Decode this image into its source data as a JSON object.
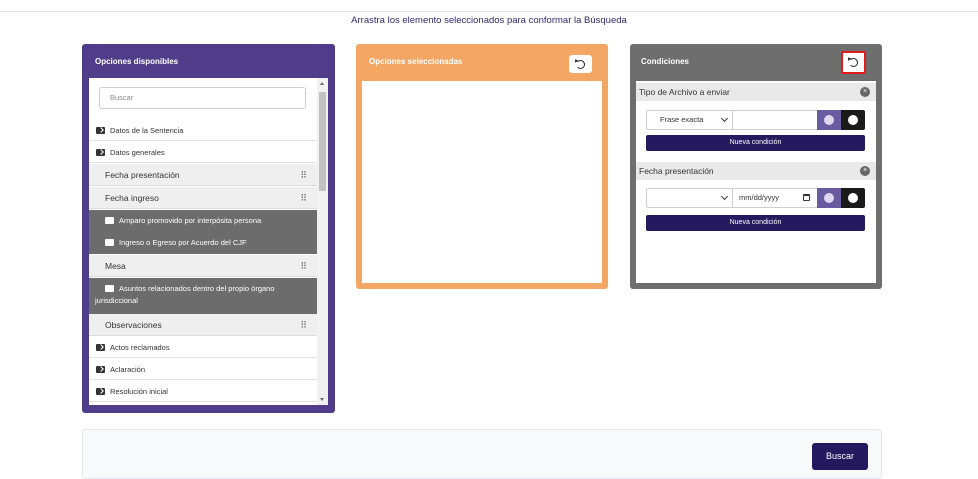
{
  "instruction": "Arrastra los elemento seleccionados para conformar la Búsqueda",
  "available": {
    "title": "Opciones disponibles",
    "search_placeholder": "Buscar",
    "items": [
      {
        "type": "folder",
        "label": "Datos de la Sentencia"
      },
      {
        "type": "folder",
        "label": "Datos generales"
      },
      {
        "type": "field",
        "label": "Fecha presentación"
      },
      {
        "type": "field",
        "label": "Fecha ingreso"
      },
      {
        "type": "subfolder",
        "label": "Amparo promovido por interpósita persona"
      },
      {
        "type": "subfolder",
        "label": "Ingreso o Egreso por Acuerdo del CJF"
      },
      {
        "type": "field",
        "label": "Mesa"
      },
      {
        "type": "subfolder",
        "label": "Asuntos relacionados dentro del propio órgano jurisdiccional"
      },
      {
        "type": "field",
        "label": "Observaciones"
      },
      {
        "type": "folder",
        "label": "Actos reclamados"
      },
      {
        "type": "folder",
        "label": "Aclaración"
      },
      {
        "type": "folder",
        "label": "Resolución inicial"
      }
    ]
  },
  "selected": {
    "title": "Opciones seleccionadas"
  },
  "conditions": {
    "title": "Condiciones",
    "items": [
      {
        "label": "Tipo de Archivo a enviar",
        "operator": "Frase exacta",
        "value": "",
        "new_label": "Nueva condición"
      },
      {
        "label": "Fecha presentación",
        "operator": "",
        "value": "mm/dd/yyyy",
        "new_label": "Nueva condición"
      }
    ]
  },
  "footer": {
    "search_label": "Buscar"
  },
  "colors": {
    "available_panel": "#4f3d8a",
    "selected_panel": "#f4a765",
    "conditions_panel": "#6e6e6e",
    "primary_button": "#24195e",
    "highlight_border": "#e11b1b"
  }
}
